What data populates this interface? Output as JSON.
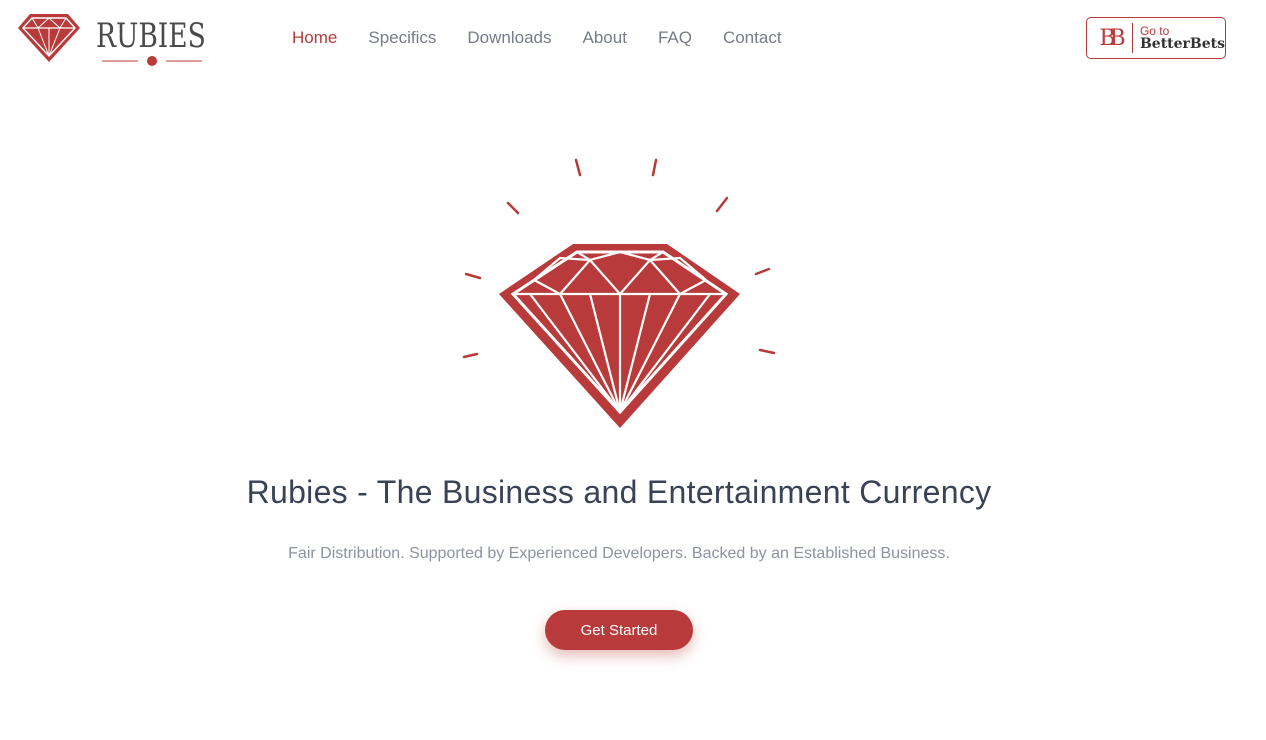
{
  "brand": {
    "name": "RUBIES",
    "accent_color": "#b83a3a"
  },
  "nav": {
    "items": [
      {
        "label": "Home",
        "active": true
      },
      {
        "label": "Specifics",
        "active": false
      },
      {
        "label": "Downloads",
        "active": false
      },
      {
        "label": "About",
        "active": false
      },
      {
        "label": "FAQ",
        "active": false
      },
      {
        "label": "Contact",
        "active": false
      }
    ]
  },
  "betterbets": {
    "mark": "BB",
    "small": "Go to",
    "big": "BetterBets"
  },
  "hero": {
    "icon": "diamond-icon",
    "headline": "Rubies - The Business and Entertainment Currency",
    "subline": "Fair Distribution. Supported by Experienced Developers. Backed by an Established Business.",
    "cta_label": "Get Started"
  }
}
